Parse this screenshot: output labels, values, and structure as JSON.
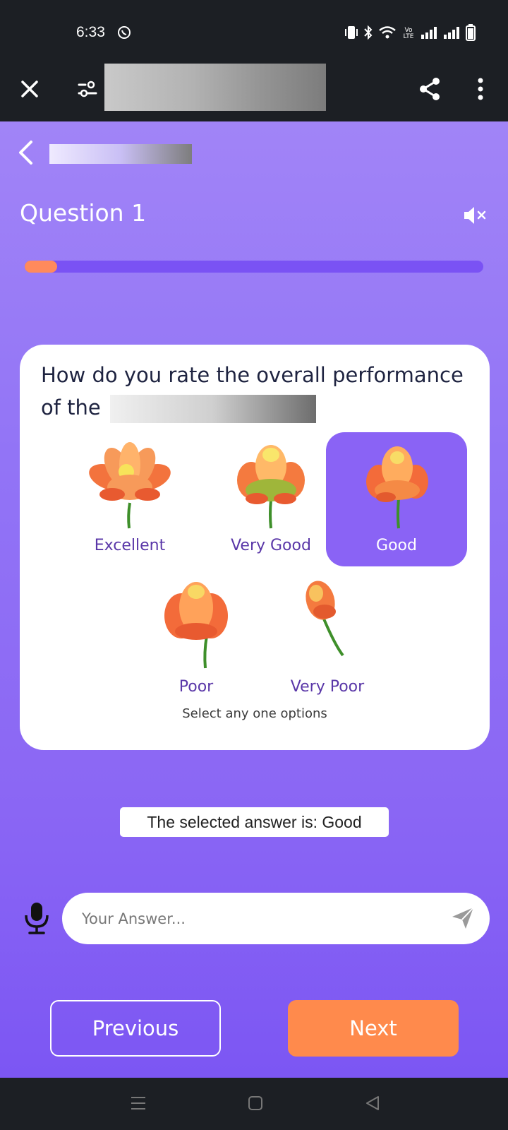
{
  "status_bar": {
    "time": "6:33",
    "icons": [
      "whatsapp-icon",
      "vibrate-icon",
      "bluetooth-icon",
      "wifi-icon",
      "volte-icon",
      "signal-icon",
      "signal-icon",
      "battery-icon"
    ],
    "volte_text": "Vo LTE"
  },
  "app_bar": {
    "icons": [
      "close-icon",
      "filter-icon",
      "share-icon",
      "more-vert-icon"
    ]
  },
  "quiz": {
    "title": "Question 1",
    "progress": 0.07,
    "question_text": "How do you rate the overall performance of the",
    "options": [
      {
        "label": "Excellent",
        "selected": false
      },
      {
        "label": "Very Good",
        "selected": false
      },
      {
        "label": "Good",
        "selected": true
      },
      {
        "label": "Poor",
        "selected": false
      },
      {
        "label": "Very Poor",
        "selected": false
      }
    ],
    "hint": "Select any one options",
    "selected_answer_text": "The selected answer is: Good"
  },
  "answer": {
    "placeholder": "Your Answer..."
  },
  "buttons": {
    "previous": "Previous",
    "next": "Next"
  },
  "colors": {
    "accent": "#8a63f5",
    "progress_fill": "#ff8a5c",
    "next_button": "#ff8a4c",
    "option_label": "#5a37a8"
  }
}
